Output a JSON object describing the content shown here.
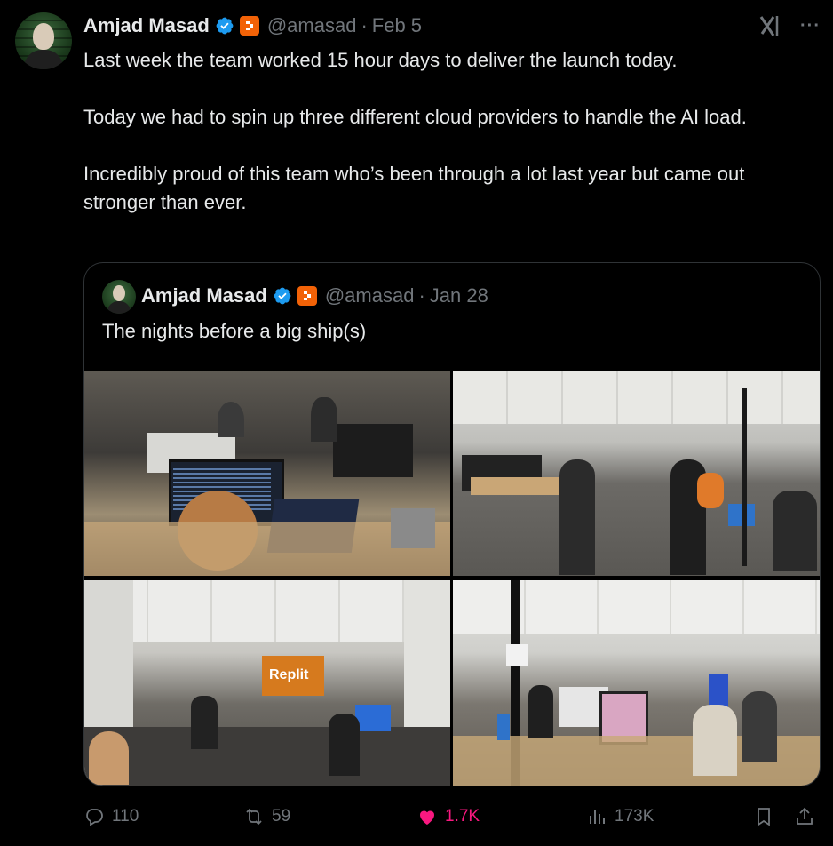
{
  "tweet": {
    "author_name": "Amjad Masad",
    "handle": "@amasad",
    "separator": "·",
    "date": "Feb 5",
    "paragraphs": [
      "Last week the team worked 15 hour days to deliver the launch today.",
      "Today we had to spin up three different cloud providers to handle the AI load.",
      "Incredibly proud of this team who’s been through a lot last year but came out stronger than ever."
    ]
  },
  "quoted": {
    "author_name": "Amjad Masad",
    "handle": "@amasad",
    "separator": "·",
    "date": "Jan 28",
    "text": "The nights before a big ship(s)"
  },
  "photo_sign_text": "Replit",
  "stats": {
    "replies": "110",
    "retweets": "59",
    "likes": "1.7K",
    "views": "173K"
  },
  "colors": {
    "background": "#000000",
    "text": "#e7e9ea",
    "muted": "#71767b",
    "verified": "#1d9bf0",
    "like": "#f91880",
    "brand_badge": "#f26207",
    "border": "#2f3336"
  },
  "icons": [
    "verified-icon",
    "replit-badge-icon",
    "grok-icon",
    "more-icon",
    "reply-icon",
    "retweet-icon",
    "like-icon",
    "views-icon",
    "bookmark-icon",
    "share-icon"
  ]
}
